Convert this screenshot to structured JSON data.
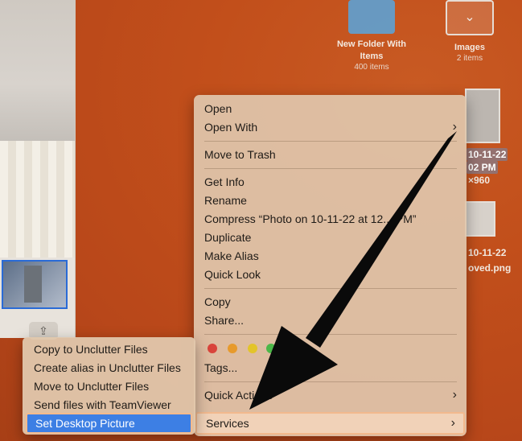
{
  "desktop": {
    "icons": [
      {
        "label": "New Folder With Items",
        "sub": "400 items"
      },
      {
        "label": "Images",
        "sub": "2 items"
      }
    ],
    "selected_file": {
      "line1": "10-11-22",
      "line2": "02 PM",
      "line3": "×960"
    },
    "second_file": {
      "line1": "10-11-22",
      "line2": "oved.png"
    }
  },
  "context_menu": {
    "open": "Open",
    "open_with": "Open With",
    "move_to_trash": "Move to Trash",
    "get_info": "Get Info",
    "rename": "Rename",
    "compress": "Compress “Photo on 10-11-22 at 12... PM”",
    "duplicate": "Duplicate",
    "make_alias": "Make Alias",
    "quick_look": "Quick Look",
    "copy": "Copy",
    "share": "Share...",
    "tags": "Tags...",
    "quick_actions": "Quick Actions",
    "services": "Services",
    "tag_colors": [
      "#d9443b",
      "#e79a2c",
      "#e3c42a",
      "#4cb748"
    ],
    "chevron": "›"
  },
  "services_submenu": {
    "items": [
      "Copy to Unclutter Files",
      "Create alias in Unclutter Files",
      "Move to Unclutter Files",
      "Send files with TeamViewer",
      "Set Desktop Picture"
    ]
  },
  "share_glyph": "⇪"
}
